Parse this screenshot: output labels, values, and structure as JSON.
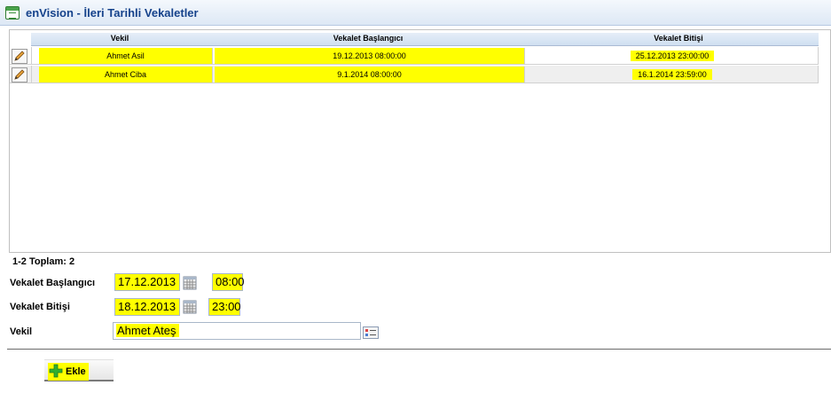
{
  "window": {
    "title": "enVision - İleri Tarihli Vekaletler"
  },
  "grid": {
    "columns": [
      "Vekil",
      "Vekalet Başlangıcı",
      "Vekalet Bitişi"
    ],
    "rows": [
      {
        "vekil": "Ahmet Asil",
        "start": "19.12.2013 08:00:00",
        "end": "25.12.2013 23:00:00"
      },
      {
        "vekil": "Ahmet Ciba",
        "start": "9.1.2014 08:00:00",
        "end": "16.1.2014 23:59:00"
      }
    ]
  },
  "footer": {
    "count_text": "1-2 Toplam: 2"
  },
  "form": {
    "start_label": "Vekalet Başlangıcı",
    "start_date": "17.12.2013",
    "start_time": "08:00",
    "end_label": "Vekalet Bitişi",
    "end_date": "18.12.2013",
    "end_time": "23:00",
    "vekil_label": "Vekil",
    "vekil_value": "Ahmet Ateş"
  },
  "actions": {
    "add_label": "Ekle"
  },
  "icons": [
    "window-icon",
    "edit-icon",
    "calendar-icon",
    "lookup-icon",
    "plus-icon"
  ],
  "colors": {
    "highlight": "#ffff00",
    "title_text": "#15428b",
    "plus_icon": "#2fb02f"
  }
}
